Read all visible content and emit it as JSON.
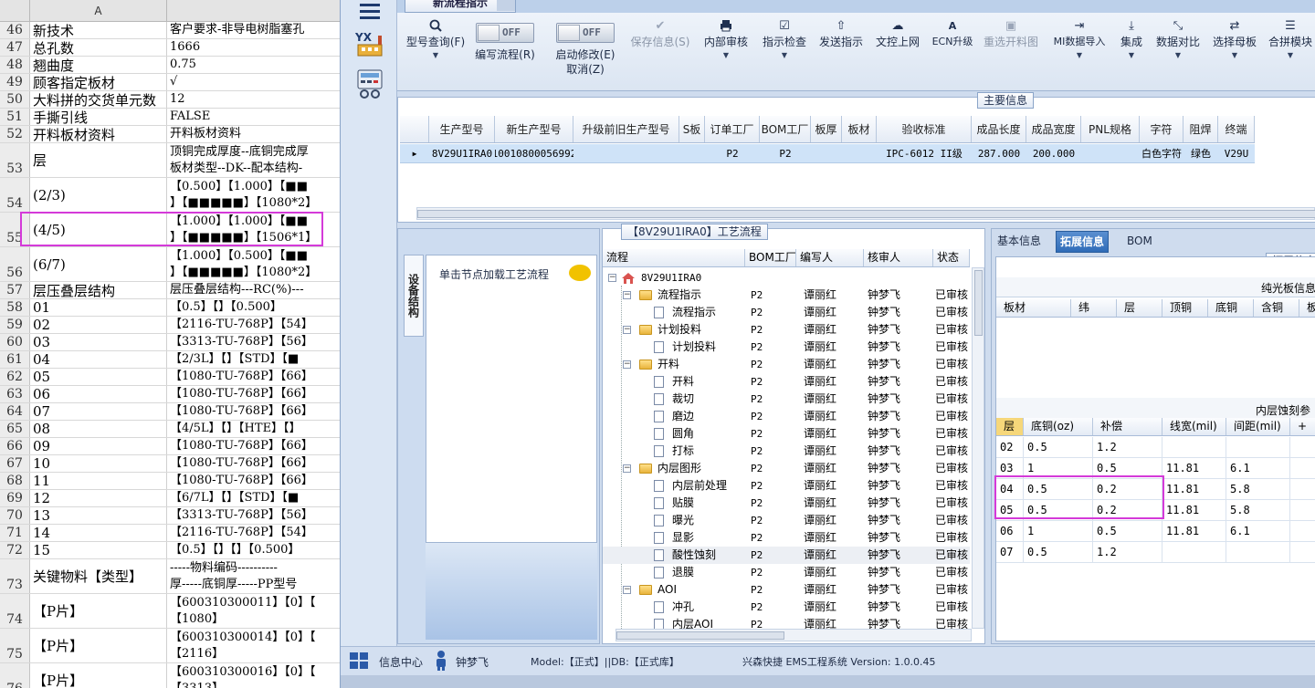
{
  "sheet": {
    "col_a": "A",
    "rows": [
      {
        "n": "46",
        "a": "新技术",
        "b": "客户要求-非导电树脂塞孔"
      },
      {
        "n": "47",
        "a": "总孔数",
        "b": "1666"
      },
      {
        "n": "48",
        "a": "翘曲度",
        "b": "0.75"
      },
      {
        "n": "49",
        "a": "顾客指定板材",
        "b": "√"
      },
      {
        "n": "50",
        "a": "大料拼的交货单元数",
        "b": "12"
      },
      {
        "n": "51",
        "a": "手撕引线",
        "b": "FALSE"
      },
      {
        "n": "52",
        "a": "开料板材资料",
        "b": "开料板材资料"
      },
      {
        "n": "53",
        "a": "层",
        "b": "顶铜完成厚度--底铜完成厚\n板材类型--DK--配本结构-"
      },
      {
        "n": "54",
        "a": "(2/3)",
        "b": "【0.500】【1.000】【■■\n】【■■■■■】【1080*2】"
      },
      {
        "n": "55",
        "a": "(4/5)",
        "b": "【1.000】【1.000】【■■\n】【■■■■■】【1506*1】"
      },
      {
        "n": "56",
        "a": "(6/7)",
        "b": "【1.000】【0.500】【■■\n】【■■■■■】【1080*2】"
      },
      {
        "n": "57",
        "a": "层压叠层结构",
        "b": "层压叠层结构---RC(%)---"
      },
      {
        "n": "58",
        "a": "01",
        "b": "【0.5】【】【0.500】"
      },
      {
        "n": "59",
        "a": "02",
        "b": "【2116-TU-768P】【54】"
      },
      {
        "n": "60",
        "a": "03",
        "b": "【3313-TU-768P】【56】"
      },
      {
        "n": "61",
        "a": "04",
        "b": "【2/3L】【】【STD】【■"
      },
      {
        "n": "62",
        "a": "05",
        "b": "【1080-TU-768P】【66】"
      },
      {
        "n": "63",
        "a": "06",
        "b": "【1080-TU-768P】【66】"
      },
      {
        "n": "64",
        "a": "07",
        "b": "【1080-TU-768P】【66】"
      },
      {
        "n": "65",
        "a": "08",
        "b": "【4/5L】【】【HTE】【】"
      },
      {
        "n": "66",
        "a": "09",
        "b": "【1080-TU-768P】【66】"
      },
      {
        "n": "67",
        "a": "10",
        "b": "【1080-TU-768P】【66】"
      },
      {
        "n": "68",
        "a": "11",
        "b": "【1080-TU-768P】【66】"
      },
      {
        "n": "69",
        "a": "12",
        "b": "【6/7L】【】【STD】【■"
      },
      {
        "n": "70",
        "a": "13",
        "b": "【3313-TU-768P】【56】"
      },
      {
        "n": "71",
        "a": "14",
        "b": "【2116-TU-768P】【54】"
      },
      {
        "n": "72",
        "a": "15",
        "b": "【0.5】【】【】【0.500】"
      },
      {
        "n": "73",
        "a": "关键物料【类型】",
        "b": "-----物料编码----------\n厚-----底铜厚-----PP型号"
      },
      {
        "n": "74",
        "a": "【P片】",
        "b": "【600310300011】【0】【\n【1080】"
      },
      {
        "n": "75",
        "a": "【P片】",
        "b": "【600310300014】【0】【\n【2116】"
      },
      {
        "n": "76",
        "a": "【P片】",
        "b": "【600310300016】【0】【\n【3313】"
      }
    ]
  },
  "app": {
    "tab_title": "新流程指示",
    "ribbon": {
      "query": "型号查询(F)",
      "write_toggle": "OFF",
      "write_label": "编写流程(R)",
      "start_toggle": "OFF",
      "start_label": "启动修改(E)",
      "cancel_label": "取消(Z)",
      "save": "保存信息(S)",
      "internal_review": "内部审核",
      "instr_check": "指示检查",
      "send_instr": "发送指示",
      "upload": "文控上网",
      "ecn": "ECN升级",
      "reselect": "重选开料图",
      "mi_import": "MI数据导入",
      "integrate": "集成",
      "compare": "数据对比",
      "select_mother": "选择母板",
      "merge_module": "合拼模块"
    },
    "main_info": {
      "title": "主要信息",
      "headers": [
        "生产型号",
        "新生产型号",
        "升级前旧生产型号",
        "S板",
        "订单工厂",
        "BOM工厂",
        "板厚",
        "板材",
        "验收标准",
        "成品长度",
        "成品宽度",
        "PNL规格",
        "字符",
        "阻焊",
        "终端"
      ],
      "row": [
        "8V29U1IRA0",
        "10010800056992",
        "",
        "",
        "P2",
        "P2",
        "",
        "",
        "IPC-6012 II级",
        "287.000",
        "200.000",
        "",
        "白色字符",
        "绿色",
        "V29U"
      ]
    },
    "device_panel": {
      "vtab": "设备结构",
      "hint": "单击节点加载工艺流程"
    },
    "flow": {
      "title": "【8V29U1IRA0】工艺流程",
      "headers": [
        "流程",
        "BOM工厂",
        "编写人",
        "核审人",
        "状态"
      ],
      "rows": [
        {
          "name": "8V29U1IRA0",
          "bom": "",
          "writer": "",
          "reviewer": "",
          "status": ""
        },
        {
          "name": "流程指示",
          "bom": "P2",
          "writer": "谭丽红",
          "reviewer": "钟梦飞",
          "status": "已审核"
        },
        {
          "name": "流程指示",
          "bom": "P2",
          "writer": "谭丽红",
          "reviewer": "钟梦飞",
          "status": "已审核"
        },
        {
          "name": "计划投料",
          "bom": "P2",
          "writer": "谭丽红",
          "reviewer": "钟梦飞",
          "status": "已审核"
        },
        {
          "name": "计划投料",
          "bom": "P2",
          "writer": "谭丽红",
          "reviewer": "钟梦飞",
          "status": "已审核"
        },
        {
          "name": "开料",
          "bom": "P2",
          "writer": "谭丽红",
          "reviewer": "钟梦飞",
          "status": "已审核"
        },
        {
          "name": "开料",
          "bom": "P2",
          "writer": "谭丽红",
          "reviewer": "钟梦飞",
          "status": "已审核"
        },
        {
          "name": "裁切",
          "bom": "P2",
          "writer": "谭丽红",
          "reviewer": "钟梦飞",
          "status": "已审核"
        },
        {
          "name": "磨边",
          "bom": "P2",
          "writer": "谭丽红",
          "reviewer": "钟梦飞",
          "status": "已审核"
        },
        {
          "name": "圆角",
          "bom": "P2",
          "writer": "谭丽红",
          "reviewer": "钟梦飞",
          "status": "已审核"
        },
        {
          "name": "打标",
          "bom": "P2",
          "writer": "谭丽红",
          "reviewer": "钟梦飞",
          "status": "已审核"
        },
        {
          "name": "内层图形",
          "bom": "P2",
          "writer": "谭丽红",
          "reviewer": "钟梦飞",
          "status": "已审核"
        },
        {
          "name": "内层前处理",
          "bom": "P2",
          "writer": "谭丽红",
          "reviewer": "钟梦飞",
          "status": "已审核"
        },
        {
          "name": "贴膜",
          "bom": "P2",
          "writer": "谭丽红",
          "reviewer": "钟梦飞",
          "status": "已审核"
        },
        {
          "name": "曝光",
          "bom": "P2",
          "writer": "谭丽红",
          "reviewer": "钟梦飞",
          "status": "已审核"
        },
        {
          "name": "显影",
          "bom": "P2",
          "writer": "谭丽红",
          "reviewer": "钟梦飞",
          "status": "已审核"
        },
        {
          "name": "酸性蚀刻",
          "bom": "P2",
          "writer": "谭丽红",
          "reviewer": "钟梦飞",
          "status": "已审核"
        },
        {
          "name": "退膜",
          "bom": "P2",
          "writer": "谭丽红",
          "reviewer": "钟梦飞",
          "status": "已审核"
        },
        {
          "name": "AOI",
          "bom": "P2",
          "writer": "谭丽红",
          "reviewer": "钟梦飞",
          "status": "已审核"
        },
        {
          "name": "冲孔",
          "bom": "P2",
          "writer": "谭丽红",
          "reviewer": "钟梦飞",
          "status": "已审核"
        },
        {
          "name": "内层AOI",
          "bom": "P2",
          "writer": "谭丽红",
          "reviewer": "钟梦飞",
          "status": "已审核"
        }
      ]
    },
    "right": {
      "tabs": [
        "基本信息",
        "拓展信息",
        "BOM"
      ],
      "ext_title": "拓展信息",
      "board_title": "纯光板信息",
      "board_headers": [
        "板材",
        "纬",
        "层",
        "顶铜",
        "底铜",
        "含铜",
        "板"
      ],
      "etch_title": "内层蚀刻参",
      "etch_headers": [
        "层",
        "底铜(oz)",
        "补偿",
        "线宽(mil)",
        "间距(mil)",
        "+"
      ],
      "etch_rows": [
        [
          "02",
          "0.5",
          "1.2",
          "",
          ""
        ],
        [
          "03",
          "1",
          "0.5",
          "11.81",
          "6.1"
        ],
        [
          "04",
          "0.5",
          "0.2",
          "11.81",
          "5.8"
        ],
        [
          "05",
          "0.5",
          "0.2",
          "11.81",
          "5.8"
        ],
        [
          "06",
          "1",
          "0.5",
          "11.81",
          "6.1"
        ],
        [
          "07",
          "0.5",
          "1.2",
          "",
          ""
        ]
      ]
    },
    "status": {
      "info_center": "信息中心",
      "user": "钟梦飞",
      "model_db": "Model:【正式】||DB:【正式库】",
      "version": "兴森快捷 EMS工程系统 Version: 1.0.0.45"
    }
  },
  "colors": {
    "highlight": "#d43ad9",
    "selected_row": "#cfe3f8",
    "active_tab": "#2f6cb8"
  }
}
